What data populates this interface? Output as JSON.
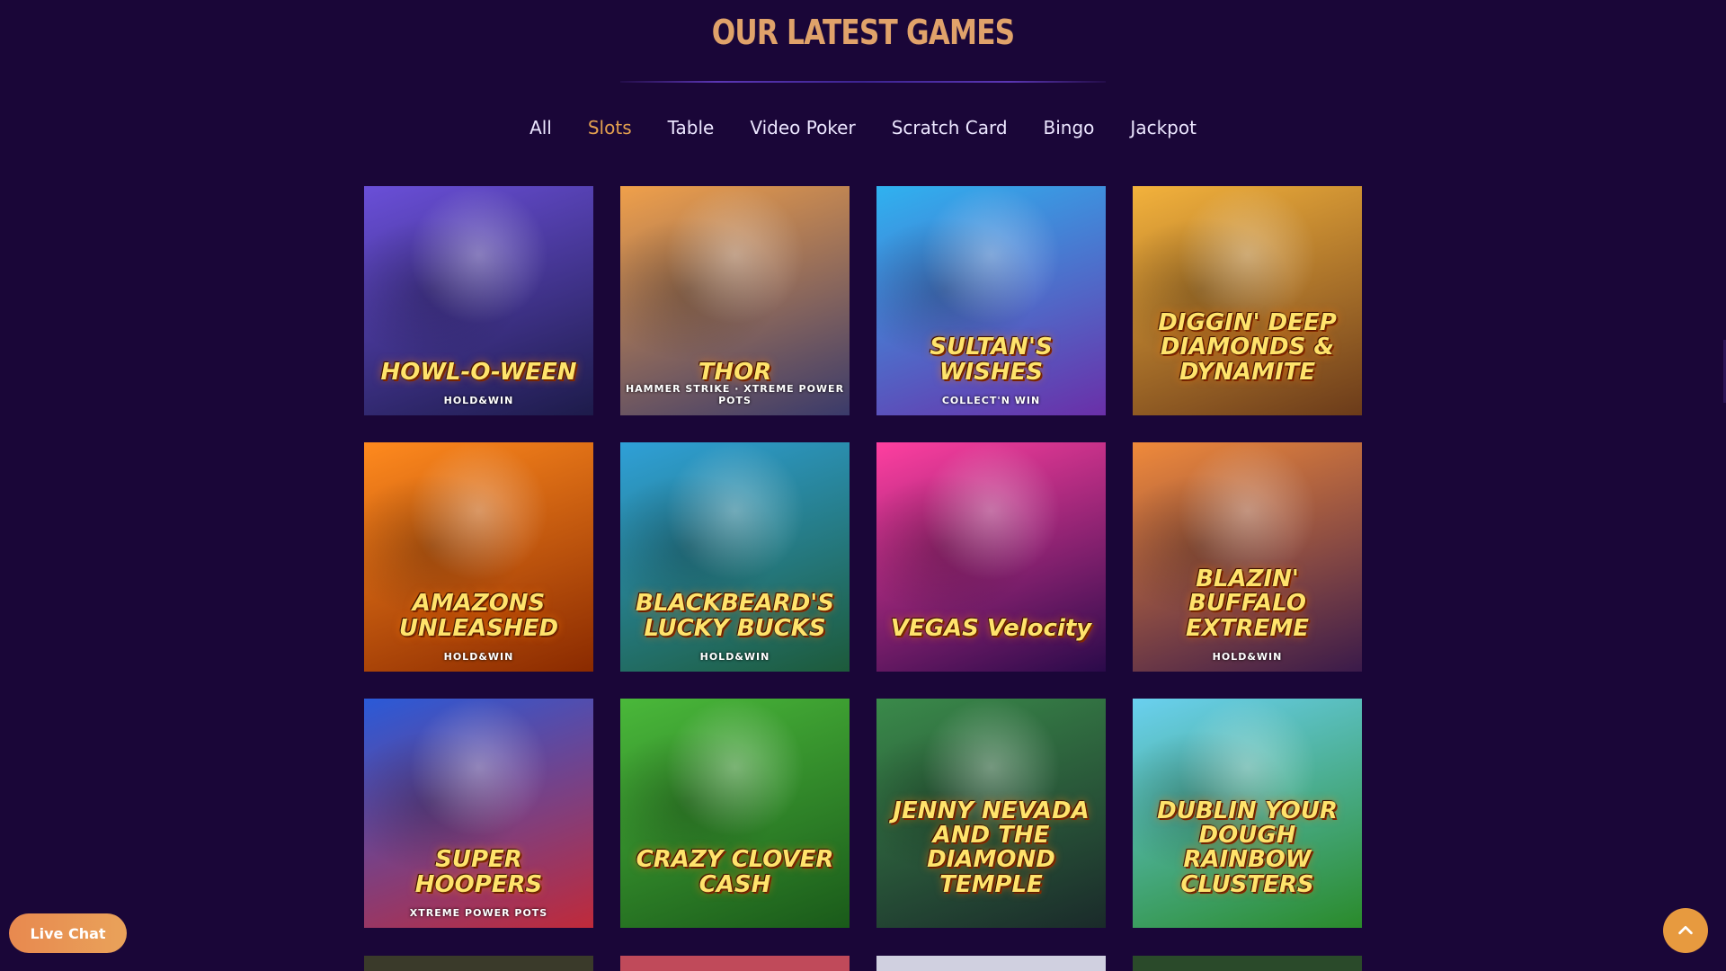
{
  "section": {
    "title": "OUR LATEST GAMES"
  },
  "filters": [
    {
      "label": "All",
      "active": false
    },
    {
      "label": "Slots",
      "active": true
    },
    {
      "label": "Table",
      "active": false
    },
    {
      "label": "Video Poker",
      "active": false
    },
    {
      "label": "Scratch Card",
      "active": false
    },
    {
      "label": "Bingo",
      "active": false
    },
    {
      "label": "Jackpot",
      "active": false
    }
  ],
  "games": [
    {
      "title": "HOWL-O-WEEN",
      "badge": "HOLD&WIN",
      "colors": [
        "#6a4fd8",
        "#1d1b4a"
      ]
    },
    {
      "title": "THOR",
      "badge": "HAMMER STRIKE · XTREME POWER POTS",
      "colors": [
        "#f0a04a",
        "#3a3a6a"
      ]
    },
    {
      "title": "SULTAN'S WISHES",
      "badge": "COLLECT'N WIN",
      "colors": [
        "#2fb2f0",
        "#6a2fa8"
      ]
    },
    {
      "title": "DIGGIN' DEEP DIAMONDS & DYNAMITE",
      "badge": "",
      "colors": [
        "#f3b23c",
        "#6b3b1a"
      ]
    },
    {
      "title": "AMAZONS UNLEASHED",
      "badge": "HOLD&WIN",
      "colors": [
        "#ff8a1e",
        "#8a2a00"
      ]
    },
    {
      "title": "BLACKBEARD'S LUCKY BUCKS",
      "badge": "HOLD&WIN",
      "colors": [
        "#2fa0d8",
        "#1d5a3a"
      ]
    },
    {
      "title": "VEGAS Velocity",
      "badge": "",
      "colors": [
        "#ff3fa0",
        "#2a0a4a"
      ]
    },
    {
      "title": "BLAZIN' BUFFALO EXTREME",
      "badge": "HOLD&WIN",
      "colors": [
        "#f08a3a",
        "#3a1a4a"
      ]
    },
    {
      "title": "SUPER HOOPERS",
      "badge": "XTREME POWER POTS",
      "colors": [
        "#2a5ad8",
        "#c02a3a"
      ]
    },
    {
      "title": "CRAZY CLOVER CASH",
      "badge": "",
      "colors": [
        "#4ab83a",
        "#1a5a1a"
      ]
    },
    {
      "title": "JENNY NEVADA AND THE DIAMOND TEMPLE",
      "badge": "",
      "colors": [
        "#3a8a4a",
        "#1a2a2a"
      ]
    },
    {
      "title": "DUBLIN YOUR DOUGH RAINBOW CLUSTERS",
      "badge": "",
      "colors": [
        "#6ad0f0",
        "#2a8a2a"
      ]
    }
  ],
  "partial_row_colors": [
    "#3a3a2a",
    "#c04a5a",
    "#d0d0e0",
    "#2a4a2a"
  ],
  "live_chat": {
    "label": "Live Chat"
  },
  "to_top": {
    "icon": "chevron-up-icon"
  }
}
